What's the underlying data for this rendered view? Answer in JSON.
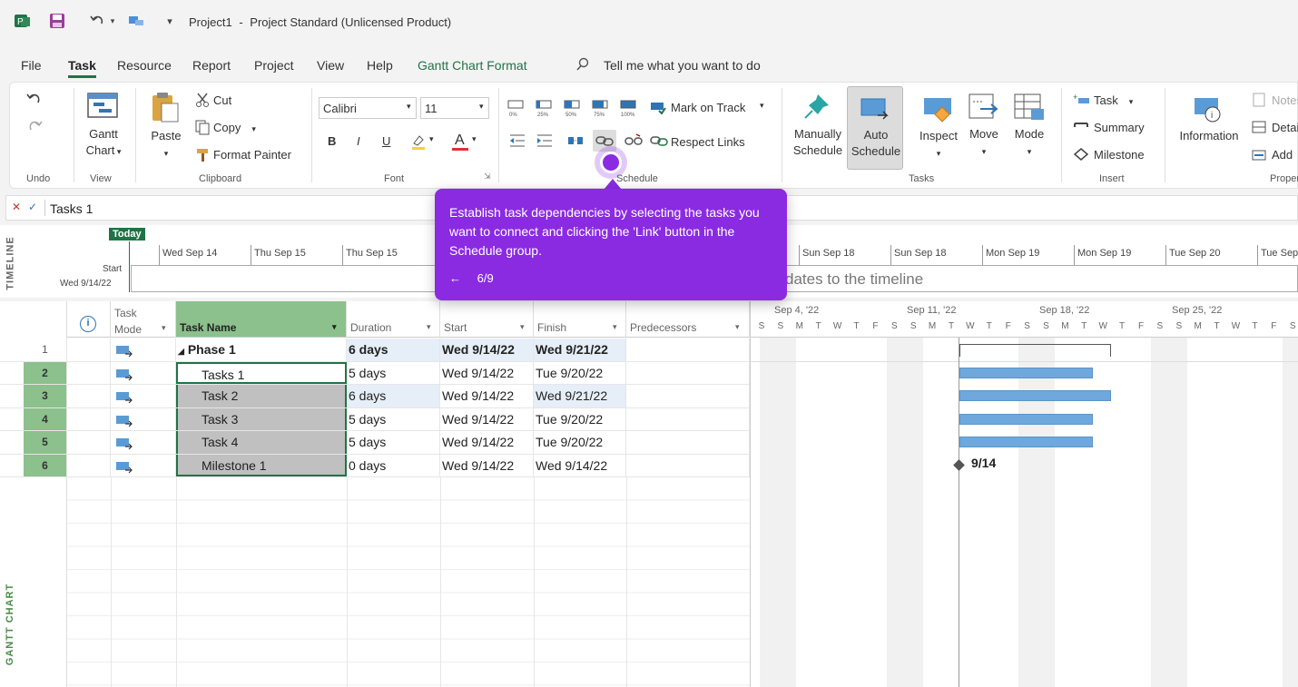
{
  "window": {
    "title": "Project1",
    "separator": "-",
    "product": "Project Standard (Unlicensed Product)"
  },
  "menu": {
    "items": [
      "File",
      "Task",
      "Resource",
      "Report",
      "Project",
      "View",
      "Help",
      "Gantt Chart Format"
    ],
    "search": "Tell me what you want to do"
  },
  "ribbon": {
    "undo_group": "Undo",
    "view": {
      "gantt_line1": "Gantt",
      "gantt_line2": "Chart",
      "group": "View"
    },
    "clipboard": {
      "paste": "Paste",
      "cut": "Cut",
      "copy": "Copy",
      "format_painter": "Format Painter",
      "group": "Clipboard"
    },
    "font": {
      "name": "Calibri",
      "size": "11",
      "bold": "B",
      "italic": "I",
      "underline": "U",
      "font_color": "A",
      "group": "Font"
    },
    "schedule": {
      "pct": [
        "0%",
        "25%",
        "50%",
        "75%",
        "100%"
      ],
      "mark_on_track": "Mark on Track",
      "respect_links": "Respect Links",
      "group": "Schedule"
    },
    "tasks": {
      "manually_1": "Manually",
      "manually_2": "Schedule",
      "auto_1": "Auto",
      "auto_2": "Schedule",
      "inspect": "Inspect",
      "move": "Move",
      "mode": "Mode",
      "group": "Tasks"
    },
    "insert": {
      "task": "Task",
      "summary": "Summary",
      "milestone": "Milestone",
      "group": "Insert"
    },
    "properties": {
      "information": "Information",
      "notes": "Notes",
      "details": "Details",
      "add": "Add",
      "group": "Properties"
    }
  },
  "formula": {
    "value": "Tasks 1"
  },
  "timeline": {
    "side_label": "TIMELINE",
    "today": "Today",
    "start_label": "Start",
    "start_date": "Wed 9/14/22",
    "dates": [
      "Wed Sep 14",
      "Thu Sep 15",
      "Thu Sep 15",
      "Sun Sep 18",
      "Sun Sep 18",
      "Mon Sep 19",
      "Mon Sep 19",
      "Tue Sep 20",
      "Tue Sep"
    ],
    "hint": "dates to the timeline"
  },
  "grid": {
    "side_label": "GANTT CHART",
    "headers": {
      "mode": "Task Mode",
      "name": "Task Name",
      "duration": "Duration",
      "start": "Start",
      "finish": "Finish",
      "predecessors": "Predecessors"
    },
    "rows": [
      {
        "id": "1",
        "name": "Phase 1",
        "duration": "6 days",
        "start": "Wed 9/14/22",
        "finish": "Wed 9/21/22"
      },
      {
        "id": "2",
        "name": "Tasks 1",
        "duration": "5 days",
        "start": "Wed 9/14/22",
        "finish": "Tue 9/20/22"
      },
      {
        "id": "3",
        "name": "Task 2",
        "duration": "6 days",
        "start": "Wed 9/14/22",
        "finish": "Wed 9/21/22"
      },
      {
        "id": "4",
        "name": "Task 3",
        "duration": "5 days",
        "start": "Wed 9/14/22",
        "finish": "Tue 9/20/22"
      },
      {
        "id": "5",
        "name": "Task 4",
        "duration": "5 days",
        "start": "Wed 9/14/22",
        "finish": "Tue 9/20/22"
      },
      {
        "id": "6",
        "name": "Milestone 1",
        "duration": "0 days",
        "start": "Wed 9/14/22",
        "finish": "Wed 9/14/22"
      }
    ]
  },
  "chart": {
    "weeks": [
      "Sep 4, '22",
      "Sep 11, '22",
      "Sep 18, '22",
      "Sep 25, '22"
    ],
    "days": [
      "S",
      "S",
      "M",
      "T",
      "W",
      "T",
      "F",
      "S",
      "S",
      "M",
      "T",
      "W",
      "T",
      "F",
      "S",
      "S",
      "M",
      "T",
      "W",
      "T",
      "F",
      "S",
      "S",
      "M",
      "T",
      "W",
      "T",
      "F",
      "S"
    ],
    "milestone_label": "9/14"
  },
  "tooltip": {
    "message": "Establish task dependencies by selecting the tasks you want to connect and clicking the 'Link' button in the Schedule group.",
    "back": "←",
    "step": "6/9"
  },
  "colors": {
    "accent": "#217346",
    "tooltip": "#8a2be2",
    "bar": "#6fa8dc",
    "selected_rows": "#8cc08c",
    "selected_cells": "#c0c0c0"
  }
}
